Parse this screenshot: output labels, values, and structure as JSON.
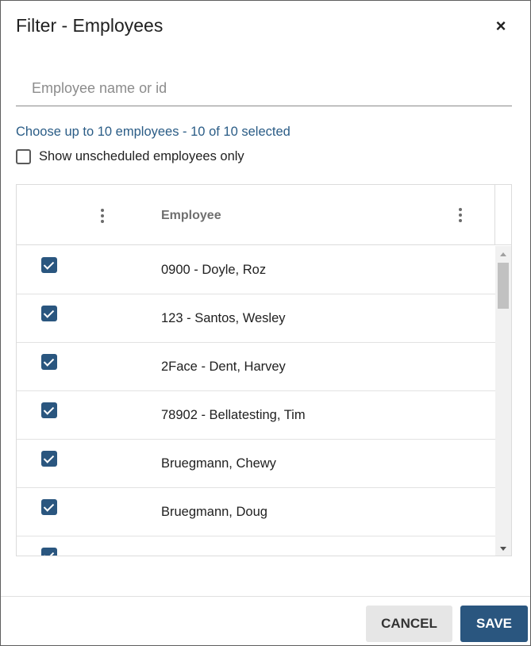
{
  "dialog": {
    "title": "Filter - Employees",
    "close_symbol": "×"
  },
  "search": {
    "value": "",
    "placeholder": "Employee name or id"
  },
  "hint": "Choose up to 10 employees - 10 of 10 selected",
  "unscheduled_toggle": {
    "label": "Show unscheduled employees only",
    "checked": false
  },
  "grid": {
    "column_header": "Employee",
    "rows": [
      {
        "label": "0900 - Doyle, Roz",
        "checked": true
      },
      {
        "label": "123 - Santos, Wesley",
        "checked": true
      },
      {
        "label": "2Face - Dent, Harvey",
        "checked": true
      },
      {
        "label": "78902 - Bellatesting, Tim",
        "checked": true
      },
      {
        "label": "Bruegmann, Chewy",
        "checked": true
      },
      {
        "label": "Bruegmann, Doug",
        "checked": true
      },
      {
        "label": "",
        "checked": true
      }
    ]
  },
  "buttons": {
    "cancel": "CANCEL",
    "save": "SAVE"
  },
  "colors": {
    "accent": "#2a567f",
    "hint_text": "#2a5c86"
  }
}
